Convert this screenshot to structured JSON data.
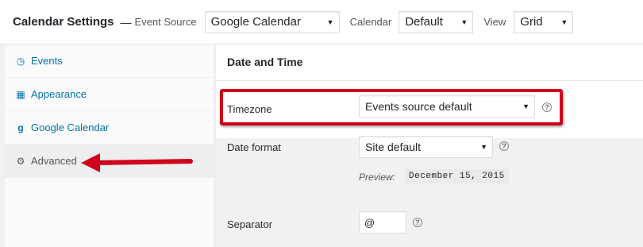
{
  "header": {
    "title": "Calendar Settings",
    "dash": "—",
    "event_source_label": "Event Source",
    "event_source_value": "Google Calendar",
    "calendar_label": "Calendar",
    "calendar_value": "Default",
    "view_label": "View",
    "view_value": "Grid"
  },
  "sidebar": {
    "items": [
      {
        "label": "Events",
        "icon": "clock-icon"
      },
      {
        "label": "Appearance",
        "icon": "calendar-icon"
      },
      {
        "label": "Google Calendar",
        "icon": "google-icon"
      },
      {
        "label": "Advanced",
        "icon": "gears-icon"
      }
    ],
    "active": "Advanced"
  },
  "main": {
    "section_title": "Date and Time",
    "timezone": {
      "label": "Timezone",
      "value": "Events source default"
    },
    "date_format": {
      "label": "Date format",
      "value": "Site default"
    },
    "preview": {
      "label": "Preview:",
      "value": "December 15, 2015"
    },
    "separator": {
      "label": "Separator",
      "value": "@"
    }
  },
  "annotation_color": "#d0021b"
}
